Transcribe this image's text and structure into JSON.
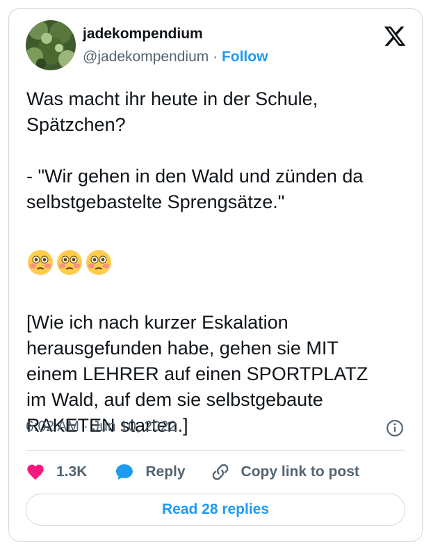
{
  "author": {
    "display_name": "jadekompendium",
    "handle": "@jadekompendium",
    "separator": "·",
    "follow_label": "Follow"
  },
  "platform_icon": "x-logo-icon",
  "tweet": {
    "line1": "Was macht ihr heute in der Schule,",
    "line2": "Spätzchen?",
    "line3": "- \"Wir gehen in den Wald und zünden da",
    "line4": "selbstgebastelte Sprengsätze.\"",
    "emojis": [
      "flushed-face-icon",
      "flushed-face-icon",
      "flushed-face-icon"
    ],
    "line5": "[Wie ich nach kurzer Eskalation",
    "line6": "herausgefunden habe, gehen sie MIT",
    "line7": "einem LEHRER auf einen SPORTPLATZ",
    "line8": "im Wald, auf dem sie selbstgebaute",
    "line9": "RAKETEN starten.]"
  },
  "timestamp": "6:02 AM · Jun 10, 2022",
  "actions": {
    "likes_count": "1.3K",
    "reply_label": "Reply",
    "copy_label": "Copy link to post"
  },
  "read_replies_label": "Read 28 replies",
  "colors": {
    "accent": "#1d9bf0",
    "heart": "#f91880",
    "text": "#0f1419",
    "muted": "#536471",
    "border": "#cfd9de"
  }
}
